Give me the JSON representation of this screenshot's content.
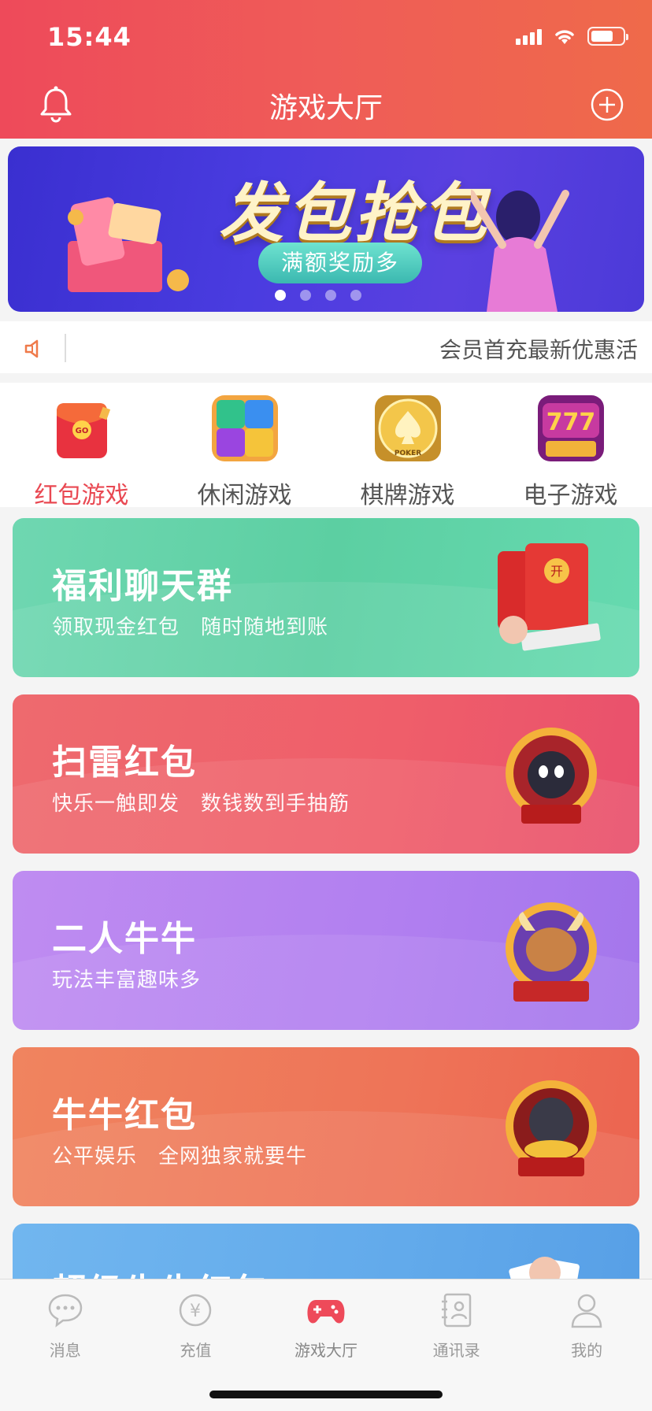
{
  "status": {
    "time": "15:44"
  },
  "header": {
    "title": "游戏大厅"
  },
  "banner": {
    "title": "发包抢包",
    "pill": "满额奖励多",
    "dots": 4,
    "active_dot": 0
  },
  "notice": {
    "text": "会员首充最新优惠活"
  },
  "categories": [
    {
      "label": "红包游戏",
      "active": true,
      "icon": "red-envelope-icon"
    },
    {
      "label": "休闲游戏",
      "active": false,
      "icon": "gem-puzzle-icon"
    },
    {
      "label": "棋牌游戏",
      "active": false,
      "icon": "poker-chip-icon"
    },
    {
      "label": "电子游戏",
      "active": false,
      "icon": "slot-777-icon"
    }
  ],
  "games": [
    {
      "title": "福利聊天群",
      "subtitle": "领取现金红包　随时随地到账",
      "color": "#5ccfa2"
    },
    {
      "title": "扫雷红包",
      "subtitle": "快乐一触即发　数钱数到手抽筋",
      "color": "#ef5e6a"
    },
    {
      "title": "二人牛牛",
      "subtitle": "玩法丰富趣味多",
      "color": "#b17ff0"
    },
    {
      "title": "牛牛红包",
      "subtitle": "公平娱乐　全网独家就要牛",
      "color": "#ee7458"
    },
    {
      "title": "超级牛牛红包",
      "subtitle": "",
      "color": "#62aaeb"
    }
  ],
  "tabbar": [
    {
      "label": "消息",
      "icon": "chat-bubble-icon",
      "active": false
    },
    {
      "label": "充值",
      "icon": "yuan-coin-icon",
      "active": false
    },
    {
      "label": "游戏大厅",
      "icon": "gamepad-icon",
      "active": true
    },
    {
      "label": "通讯录",
      "icon": "contacts-icon",
      "active": false
    },
    {
      "label": "我的",
      "icon": "profile-icon",
      "active": false
    }
  ],
  "colors": {
    "accent": "#ee4a5a",
    "active_label": "#e94852"
  }
}
